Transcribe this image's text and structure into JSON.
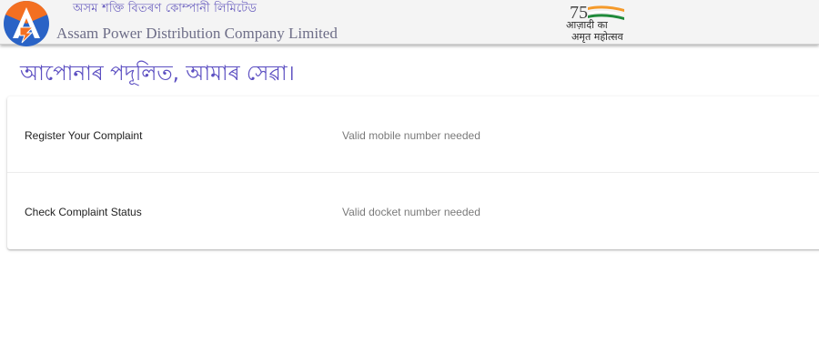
{
  "header": {
    "brand_bn": "অসম শক্তি বিতৰণ কোম্পানী লিমিটেড",
    "brand_en": "Assam Power Distribution Company Limited",
    "azadi_line1": "आज़ादी का",
    "azadi_line2": "अमृत महोत्सव",
    "azadi_number": "75"
  },
  "main": {
    "tagline": "আপোনাৰ পদূলিত, আমাৰ সেৱা।",
    "options": [
      {
        "label": "Register Your Complaint",
        "hint": "Valid mobile number needed"
      },
      {
        "label": "Check Complaint Status",
        "hint": "Valid docket number needed"
      }
    ]
  },
  "colors": {
    "brand_purple": "#5c4fc2",
    "logo_orange": "#f36f21",
    "logo_blue": "#2a63c6",
    "flag_saffron": "#f59a2a",
    "flag_green": "#1f8a3a"
  },
  "icons": {
    "logo": "apdcl-logo-icon",
    "azadi": "azadi-ka-amrit-mahotsav-logo"
  }
}
